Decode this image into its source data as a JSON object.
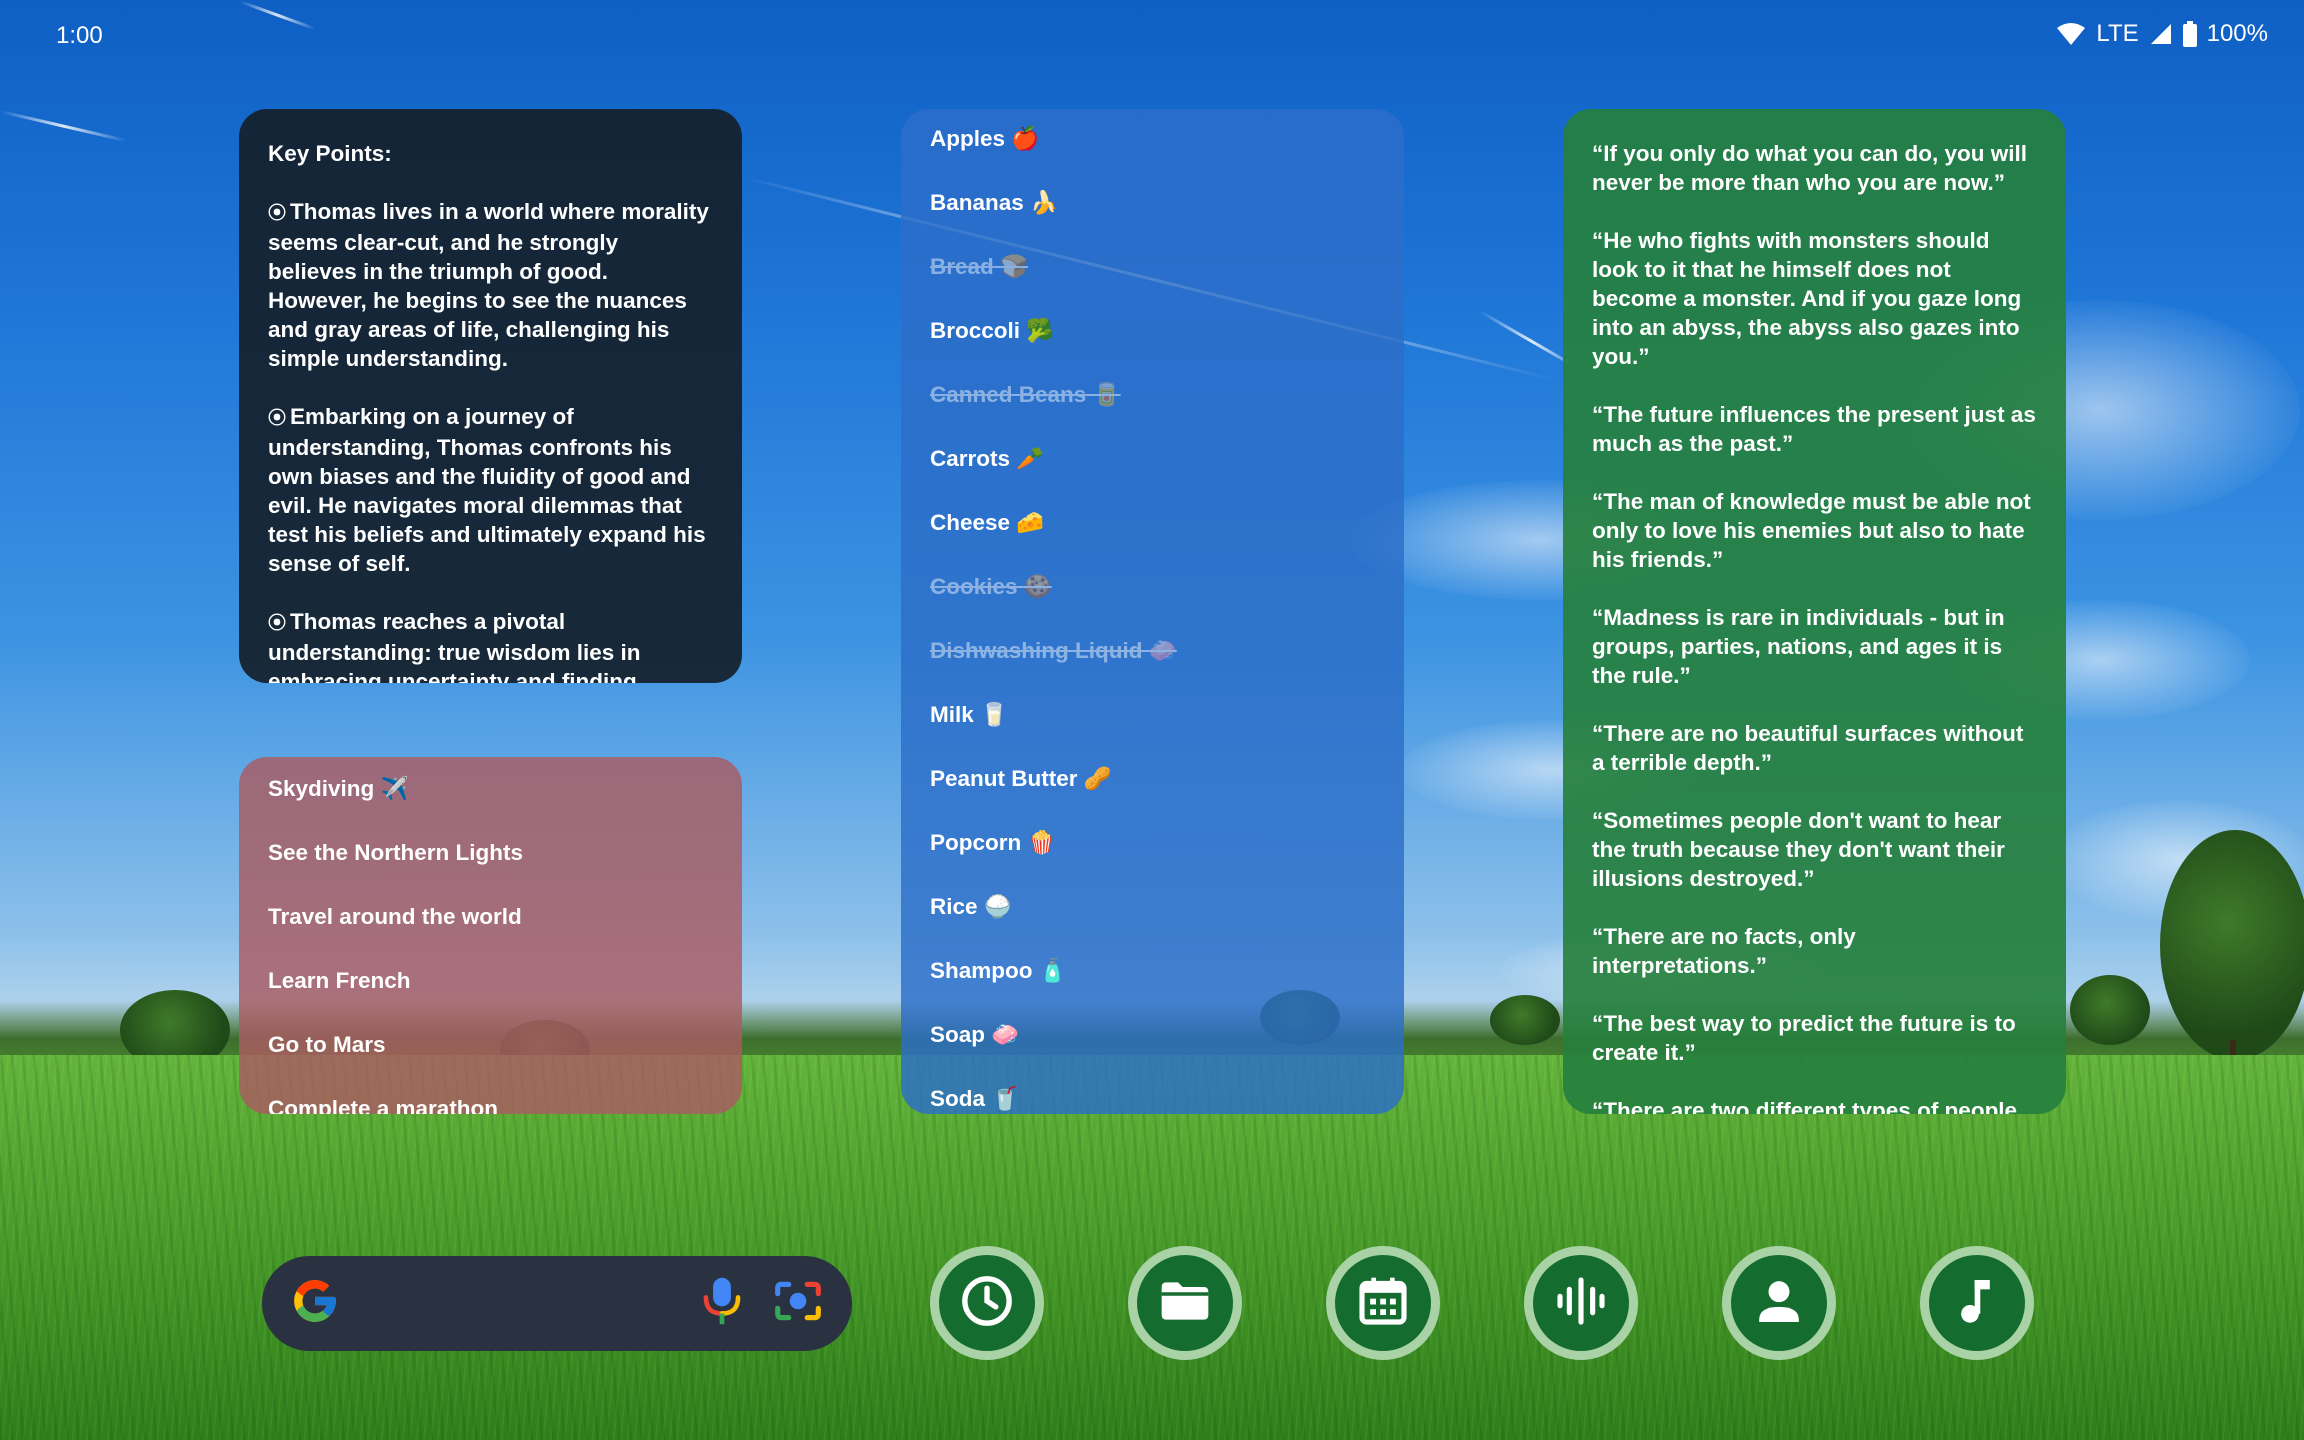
{
  "status_bar": {
    "time": "1:00",
    "network": "LTE",
    "battery": "100%"
  },
  "notes_widget": {
    "title": "Key Points:",
    "bullet_symbol": "⦿",
    "paragraphs": [
      "Thomas lives in a world where morality seems clear-cut, and he strongly believes in the triumph of good. However, he begins to see the nuances and gray areas of life, challenging his simple understanding.",
      "Embarking on a journey of understanding, Thomas confronts his own biases and the fluidity of good and evil. He navigates moral dilemmas that test his beliefs and ultimately expand his sense of self.",
      "Thomas reaches a pivotal understanding: true wisdom lies in embracing uncertainty and finding"
    ]
  },
  "bucket_list_widget": {
    "items": [
      {
        "label": "Skydiving",
        "emoji": "✈️"
      },
      {
        "label": "See the Northern Lights",
        "emoji": ""
      },
      {
        "label": "Travel around the world",
        "emoji": ""
      },
      {
        "label": "Learn French",
        "emoji": ""
      },
      {
        "label": "Go to Mars",
        "emoji": ""
      },
      {
        "label": "Complete a marathon",
        "emoji": ""
      }
    ]
  },
  "shopping_list_widget": {
    "items": [
      {
        "label": "Apples",
        "emoji": "🍎",
        "done": false
      },
      {
        "label": "Bananas",
        "emoji": "🍌",
        "done": false
      },
      {
        "label": "Bread",
        "emoji": "🍞",
        "done": true
      },
      {
        "label": "Broccoli",
        "emoji": "🥦",
        "done": false
      },
      {
        "label": "Canned Beans",
        "emoji": "🥫",
        "done": true
      },
      {
        "label": "Carrots",
        "emoji": "🥕",
        "done": false
      },
      {
        "label": "Cheese",
        "emoji": "🧀",
        "done": false
      },
      {
        "label": "Cookies",
        "emoji": "🍪",
        "done": true
      },
      {
        "label": "Dishwashing Liquid",
        "emoji": "🧼",
        "done": true
      },
      {
        "label": "Milk",
        "emoji": "🥛",
        "done": false
      },
      {
        "label": "Peanut Butter",
        "emoji": "🥜",
        "done": false
      },
      {
        "label": "Popcorn",
        "emoji": "🍿",
        "done": false
      },
      {
        "label": "Rice",
        "emoji": "🍚",
        "done": false
      },
      {
        "label": "Shampoo",
        "emoji": "🧴",
        "done": false
      },
      {
        "label": "Soap",
        "emoji": "🧼",
        "done": false
      },
      {
        "label": "Soda",
        "emoji": "🥤",
        "done": false
      }
    ]
  },
  "quotes_widget": {
    "quotes": [
      "“If you only do what you can do, you will never be more than who you are now.”",
      "“He who fights with monsters should look to it that he himself does not become a monster. And if you gaze long into an abyss, the abyss also gazes into you.”",
      "“The future influences the present just as much as the past.”",
      "“The man of knowledge must be able not only to love his enemies but also to hate his friends.”",
      "“Madness is rare in individuals - but in groups, parties, nations, and ages it is the rule.”",
      "“There are no beautiful surfaces without a terrible depth.”",
      "“Sometimes people don't want to hear the truth because they don't want their illusions destroyed.”",
      "“There are no facts, only interpretations.”",
      "“The best way to predict the future is to create it.”",
      "“There are two different types of people"
    ]
  },
  "dock": {
    "search_icons": [
      "google-g-icon",
      "microphone-icon",
      "lens-camera-icon"
    ],
    "apps": [
      {
        "name": "clock",
        "icon": "clock-icon"
      },
      {
        "name": "files",
        "icon": "folder-icon"
      },
      {
        "name": "calendar",
        "icon": "calendar-icon"
      },
      {
        "name": "recorder",
        "icon": "waveform-icon"
      },
      {
        "name": "contacts",
        "icon": "person-icon"
      },
      {
        "name": "music",
        "icon": "music-note-icon"
      }
    ],
    "colors": {
      "icon_ring": "#a9d3a6",
      "icon_fill": "#146c2e",
      "search_bg": "#2a3140"
    }
  }
}
